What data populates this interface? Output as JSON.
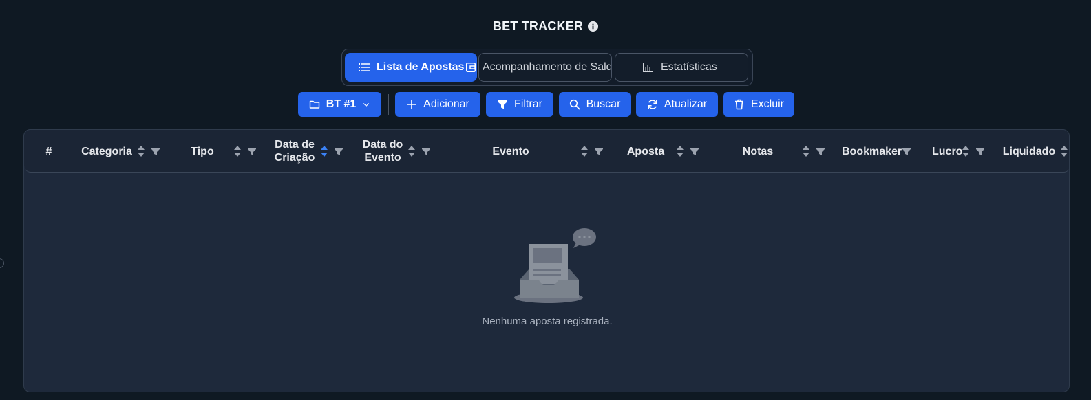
{
  "app": {
    "title": "BET TRACKER"
  },
  "tabs": [
    {
      "label": "Lista de Apostas",
      "icon": "list-icon",
      "active": true
    },
    {
      "label": "Acompanhamento de Saldo",
      "icon": "wallet-icon",
      "active": false
    },
    {
      "label": "Estatísticas",
      "icon": "bar-chart-icon",
      "active": false
    }
  ],
  "toolbar": {
    "tracker_select": "BT #1",
    "add_label": "Adicionar",
    "filter_label": "Filtrar",
    "search_label": "Buscar",
    "refresh_label": "Atualizar",
    "delete_label": "Excluir"
  },
  "table": {
    "columns": [
      {
        "key": "index",
        "line1": "#",
        "line2": "",
        "sortable": false,
        "filterable": false
      },
      {
        "key": "categoria",
        "line1": "Categoria",
        "line2": "",
        "sortable": true,
        "filterable": true
      },
      {
        "key": "tipo",
        "line1": "Tipo",
        "line2": "",
        "sortable": true,
        "filterable": true
      },
      {
        "key": "data_criacao",
        "line1": "Data de",
        "line2": "Criação",
        "sortable": true,
        "filterable": true,
        "sort_direction": "active"
      },
      {
        "key": "data_evento",
        "line1": "Data do",
        "line2": "Evento",
        "sortable": true,
        "filterable": true
      },
      {
        "key": "evento",
        "line1": "Evento",
        "line2": "",
        "sortable": true,
        "filterable": true
      },
      {
        "key": "aposta",
        "line1": "Aposta",
        "line2": "",
        "sortable": true,
        "filterable": true
      },
      {
        "key": "notas",
        "line1": "Notas",
        "line2": "",
        "sortable": true,
        "filterable": true
      },
      {
        "key": "bookmaker",
        "line1": "Bookmaker",
        "line2": "",
        "sortable": false,
        "filterable": true
      },
      {
        "key": "lucro",
        "line1": "Lucro",
        "line2": "",
        "sortable": true,
        "filterable": true
      },
      {
        "key": "liquidado",
        "line1": "Liquidado",
        "line2": "",
        "sortable": true,
        "filterable": false
      }
    ],
    "rows": [],
    "empty_message": "Nenhuma aposta registrada."
  },
  "colors": {
    "background": "#0f1923",
    "primary": "#2563eb",
    "surface": "#1e293b",
    "active_sort": "#3b82f6"
  }
}
